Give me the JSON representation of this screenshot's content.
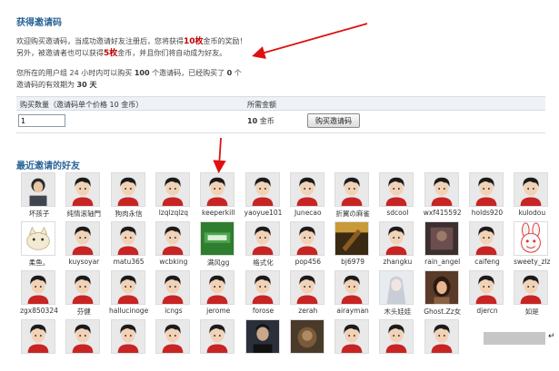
{
  "header": {
    "title": "获得邀请码"
  },
  "intro": {
    "line1_a": "欢迎购买邀请码，当成功邀请好友注册后，您将获得",
    "line1_reward": "10枚",
    "line1_b": "金币的奖励！",
    "line2_a": "另外，被邀请者也可以获得",
    "line2_reward": "5枚",
    "line2_b": "金币，并且你们将自动成为好友。"
  },
  "quota": {
    "line1_a": "您所在的用户组",
    "line1_hours": "24",
    "line1_b": "小时内可以购买",
    "line1_count": "100",
    "line1_c": "个邀请码，已经购买了",
    "line1_bought": "0",
    "line1_d": "个",
    "line2_a": "邀请码的有效期为",
    "line2_days": "30 天"
  },
  "purchase": {
    "col_qty_header": "购买数量（邀请码单个价格 10 金币）",
    "col_price_header": "所需金额",
    "qty_value": "1",
    "price_value": "10",
    "price_unit": "金币",
    "buy_button": "购买邀请码"
  },
  "friends": {
    "title": "最近邀请的好友",
    "items": [
      {
        "name": "坏孩子",
        "avatar": "photo-person"
      },
      {
        "name": "纯情滚轴門",
        "avatar": "default"
      },
      {
        "name": "狗肉永信",
        "avatar": "default"
      },
      {
        "name": "lzqlzqlzq",
        "avatar": "default"
      },
      {
        "name": "keeperkill",
        "avatar": "default"
      },
      {
        "name": "yaoyue101",
        "avatar": "default"
      },
      {
        "name": "Junecao",
        "avatar": "default"
      },
      {
        "name": "折翼の麻雀",
        "avatar": "default"
      },
      {
        "name": "sdcool",
        "avatar": "default"
      },
      {
        "name": "wxf415592",
        "avatar": "default"
      },
      {
        "name": "holds920",
        "avatar": "default"
      },
      {
        "name": "kulodou",
        "avatar": "default"
      },
      {
        "name": "柔鱼。",
        "avatar": "cartoon-cat"
      },
      {
        "name": "kuysoyar",
        "avatar": "default"
      },
      {
        "name": "matu365",
        "avatar": "default"
      },
      {
        "name": "wcbking",
        "avatar": "default"
      },
      {
        "name": "满风gg",
        "avatar": "green-logo"
      },
      {
        "name": "格式化",
        "avatar": "default"
      },
      {
        "name": "pop456",
        "avatar": "default"
      },
      {
        "name": "bj6979",
        "avatar": "photo-guitar"
      },
      {
        "name": "zhangku",
        "avatar": "default"
      },
      {
        "name": "rain_angel",
        "avatar": "photo-dark"
      },
      {
        "name": "caifeng",
        "avatar": "default"
      },
      {
        "name": "sweety_zlz",
        "avatar": "cartoon-rabbit"
      },
      {
        "name": "zgx850324",
        "avatar": "default"
      },
      {
        "name": "芬健",
        "avatar": "default"
      },
      {
        "name": "hallucinoge",
        "avatar": "default"
      },
      {
        "name": "icngs",
        "avatar": "default"
      },
      {
        "name": "jerome",
        "avatar": "default"
      },
      {
        "name": "forose",
        "avatar": "default"
      },
      {
        "name": "zerah",
        "avatar": "default"
      },
      {
        "name": "airayman",
        "avatar": "default"
      },
      {
        "name": "木头娃娃",
        "avatar": "photo-anime"
      },
      {
        "name": "Ghost.Zz女",
        "avatar": "photo-girl"
      },
      {
        "name": "djercn",
        "avatar": "default"
      },
      {
        "name": "如是",
        "avatar": "default"
      },
      {
        "name": "",
        "avatar": "default"
      },
      {
        "name": "",
        "avatar": "default"
      },
      {
        "name": "",
        "avatar": "default"
      },
      {
        "name": "",
        "avatar": "default"
      },
      {
        "name": "",
        "avatar": "default"
      },
      {
        "name": "",
        "avatar": "photo-man"
      },
      {
        "name": "",
        "avatar": "photo-dark2"
      },
      {
        "name": "",
        "avatar": "default"
      },
      {
        "name": "",
        "avatar": "default"
      },
      {
        "name": "",
        "avatar": "default"
      }
    ]
  },
  "colors": {
    "title": "#2a6496",
    "accent_red": "#c00000",
    "arrow": "#e01010"
  }
}
